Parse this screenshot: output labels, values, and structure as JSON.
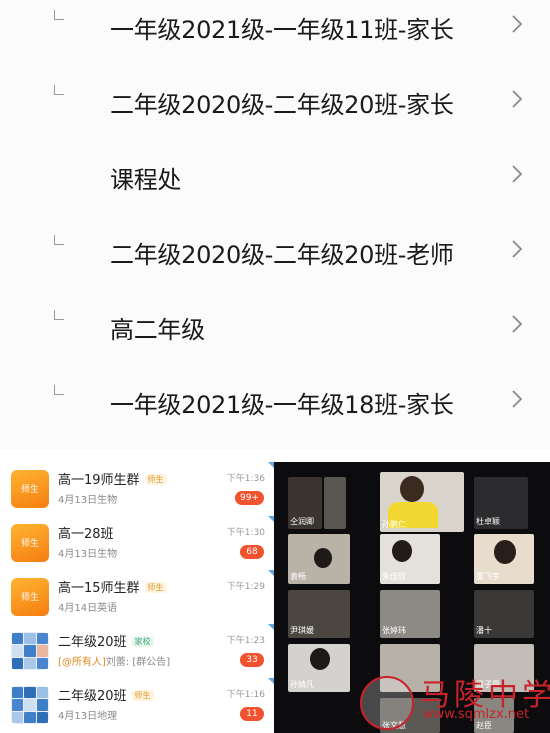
{
  "top_list": {
    "rows": [
      {
        "label": "一年级2021级-一年级11班-家长",
        "has_mark": true
      },
      {
        "label": "二年级2020级-二年级20班-家长",
        "has_mark": true
      },
      {
        "label": "课程处",
        "has_mark": false
      },
      {
        "label": "二年级2020级-二年级20班-老师",
        "has_mark": true
      },
      {
        "label": "高二年级",
        "has_mark": true
      },
      {
        "label": "一年级2021级-一年级18班-家长",
        "has_mark": true
      }
    ]
  },
  "chat_list": {
    "items": [
      {
        "avatar": "师生",
        "avatar_type": "orange",
        "title": "高一19师生群",
        "tag": "师生",
        "tag_type": "orange",
        "subtitle": "4月13日生物",
        "mention": "",
        "time": "下午1:36",
        "badge": "99+"
      },
      {
        "avatar": "师生",
        "avatar_type": "orange",
        "title": "高一28班",
        "tag": "",
        "tag_type": "",
        "subtitle": "4月13日生物",
        "mention": "",
        "time": "下午1:30",
        "badge": "68"
      },
      {
        "avatar": "师生",
        "avatar_type": "orange",
        "title": "高一15师生群",
        "tag": "师生",
        "tag_type": "orange",
        "subtitle": "4月14日英语",
        "mention": "",
        "time": "下午1:29",
        "badge": ""
      },
      {
        "avatar": "",
        "avatar_type": "grid",
        "title": "二年级20班",
        "tag": "家校",
        "tag_type": "green",
        "subtitle": "刘蕾: [群公告]",
        "mention": "[@所有人]",
        "time": "下午1:23",
        "badge": "33"
      },
      {
        "avatar": "",
        "avatar_type": "grid",
        "title": "二年级20班",
        "tag": "师生",
        "tag_type": "orange",
        "subtitle": "4月13日地理",
        "mention": "",
        "time": "下午1:16",
        "badge": "11"
      }
    ]
  },
  "video_grid": {
    "participants": [
      "仝润卿",
      "孙鹏仁",
      "杜卓颖",
      "袁畅",
      "朱佳欣",
      "董飞宇",
      "尹琪媛",
      "张婷玮",
      "潘十",
      "孙婧凡",
      "周子霖",
      "张文慧",
      "赵臣"
    ]
  },
  "watermark": {
    "title": "马陵中学",
    "url": "www.sqmlzx.net"
  },
  "colors": {
    "accent_orange": "#f57d10",
    "badge_red": "#f2522e",
    "watermark_red": "#c8232b"
  }
}
